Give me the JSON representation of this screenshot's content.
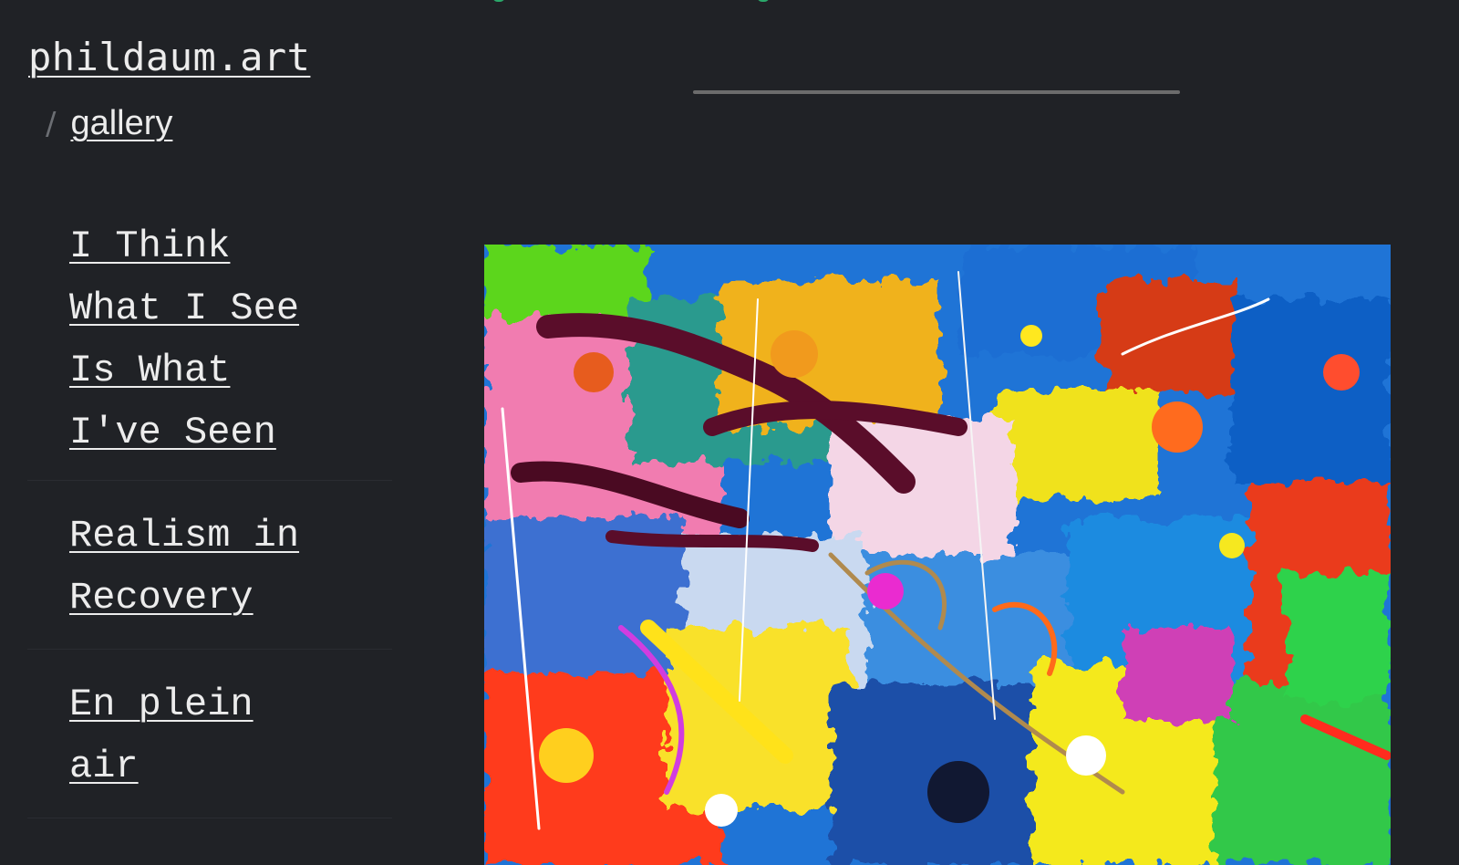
{
  "site": {
    "title": "phildaum.art",
    "breadcrumb_separator": "/",
    "breadcrumb_current": "gallery"
  },
  "sidebar": {
    "items": [
      {
        "label": "I Think What I See Is What I've Seen"
      },
      {
        "label": "Realism in Recovery"
      },
      {
        "label": "En plein air"
      }
    ]
  },
  "colors": {
    "background": "#202226",
    "link": "#ececec",
    "separator": "#6b6e73",
    "rule": "#6c6c6c",
    "accent": "#2aa86a"
  }
}
